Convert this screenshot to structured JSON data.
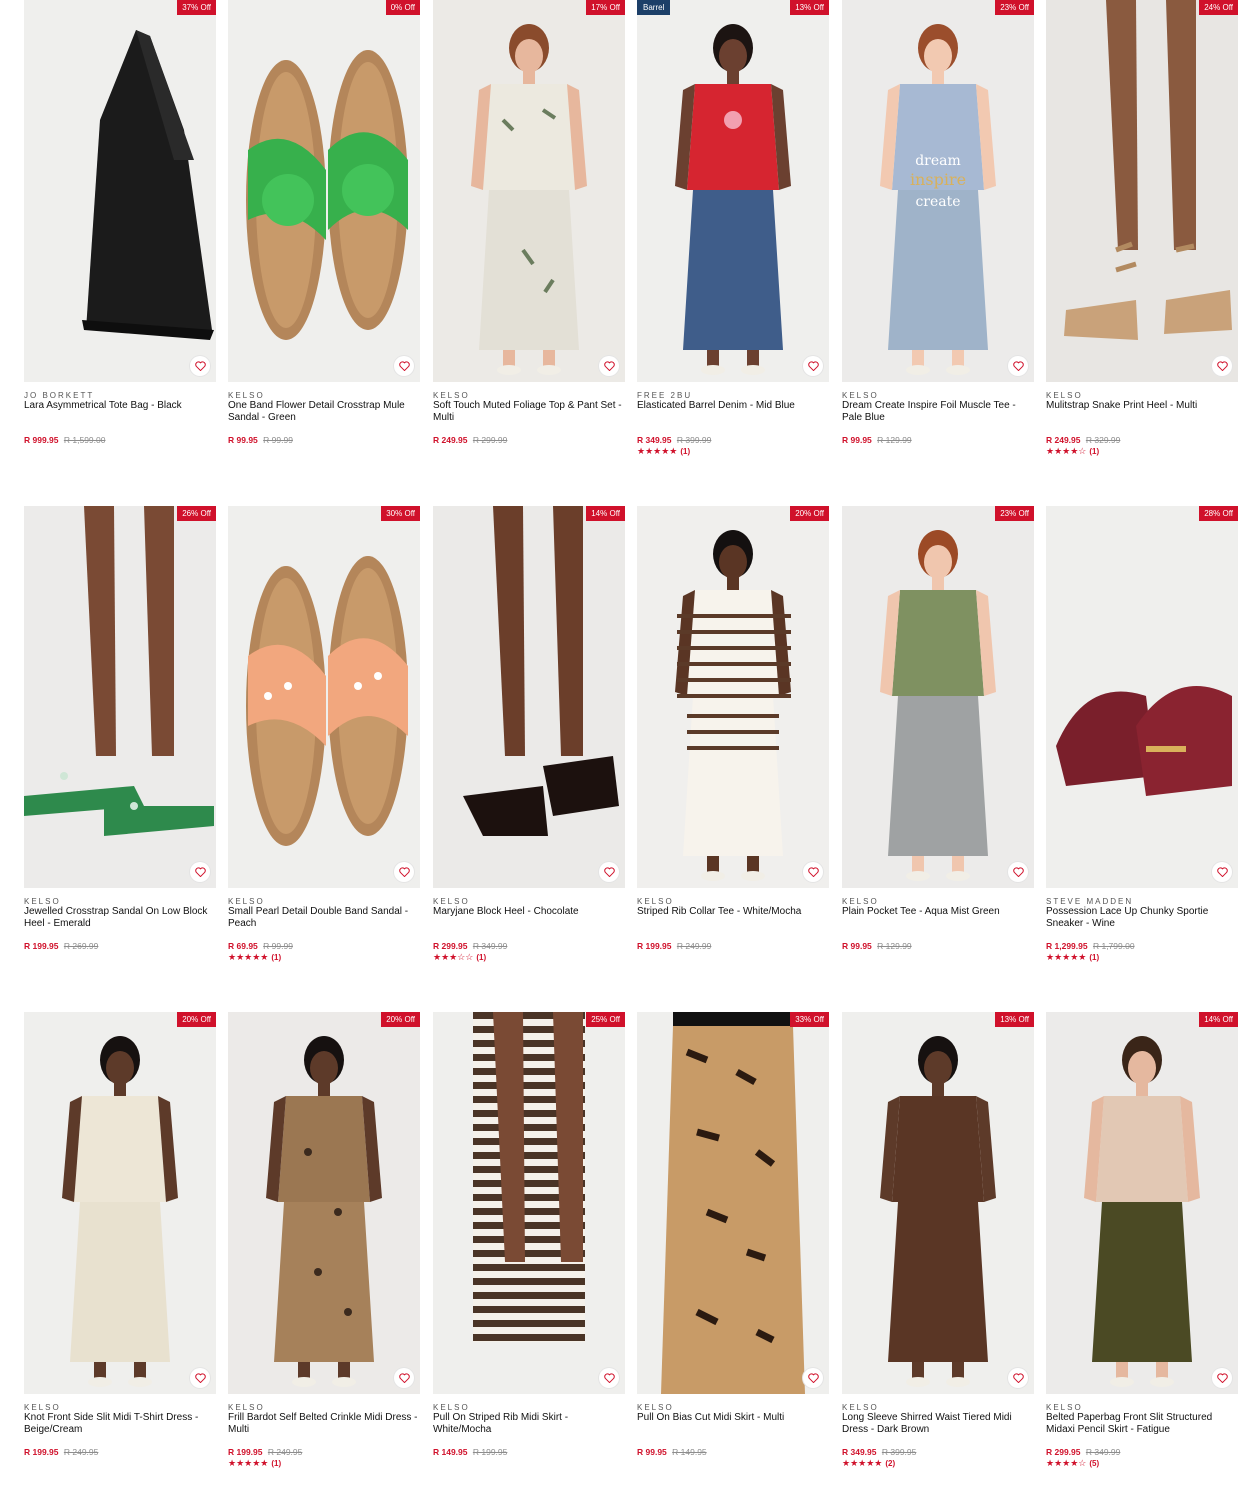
{
  "colors": {
    "accent": "#d0112b",
    "tag_blue": "#1c3f68",
    "strike": "#8d8d8d"
  },
  "products": [
    {
      "brand": "JO BORKETT",
      "name": "Lara Asymmetrical Tote Bag - Black",
      "price": "R 999.95",
      "was": "R 1,599.00",
      "badge": "37% Off",
      "rating": "",
      "count": "",
      "image": "tote-bag-image"
    },
    {
      "brand": "KELSO",
      "name": "One Band Flower Detail Crosstrap Mule Sandal - Green",
      "price": "R 99.95",
      "was": "R 99.99",
      "badge": "0% Off",
      "rating": "",
      "count": "",
      "image": "sandal-image"
    },
    {
      "brand": "KELSO",
      "name": "Soft Touch Muted Foliage Top & Pant Set - Multi",
      "price": "R 249.95",
      "was": "R 299.99",
      "badge": "17% Off",
      "rating": "",
      "count": "",
      "image": "pyjama-set-image"
    },
    {
      "brand": "FREE 2BU",
      "name": "Elasticated Barrel Denim - Mid Blue",
      "price": "R 349.95",
      "was": "R 399.99",
      "badge": "13% Off",
      "tag": "Barrel",
      "rating": "★★★★★",
      "count": "(1)",
      "image": "denim-image"
    },
    {
      "brand": "KELSO",
      "name": "Dream Create Inspire Foil Muscle Tee - Pale Blue",
      "price": "R 99.95",
      "was": "R 129.99",
      "badge": "23% Off",
      "rating": "",
      "count": "",
      "image": "tee-image"
    },
    {
      "brand": "KELSO",
      "name": "Mulitstrap Snake Print Heel - Multi",
      "price": "R 249.95",
      "was": "R 329.99",
      "badge": "24% Off",
      "rating": "★★★★☆",
      "count": "(1)",
      "image": "heel-image"
    },
    {
      "brand": "KELSO",
      "name": "Jewelled Crosstrap Sandal On Low Block Heel - Emerald",
      "price": "R 199.95",
      "was": "R 269.99",
      "badge": "26% Off",
      "rating": "",
      "count": "",
      "image": "sandal-image"
    },
    {
      "brand": "KELSO",
      "name": "Small Pearl Detail Double Band Sandal - Peach",
      "price": "R 69.95",
      "was": "R 99.99",
      "badge": "30% Off",
      "rating": "★★★★★",
      "count": "(1)",
      "image": "sandal-image"
    },
    {
      "brand": "KELSO",
      "name": "Maryjane Block Heel - Chocolate",
      "price": "R 299.95",
      "was": "R 349.99",
      "badge": "14% Off",
      "rating": "★★★☆☆",
      "count": "(1)",
      "image": "heel-image"
    },
    {
      "brand": "KELSO",
      "name": "Striped Rib Collar Tee - White/Mocha",
      "price": "R 199.95",
      "was": "R 249.99",
      "badge": "20% Off",
      "rating": "",
      "count": "",
      "image": "tee-image"
    },
    {
      "brand": "KELSO",
      "name": "Plain Pocket Tee - Aqua Mist Green",
      "price": "R 99.95",
      "was": "R 129.99",
      "badge": "23% Off",
      "rating": "",
      "count": "",
      "image": "tee-image"
    },
    {
      "brand": "STEVE MADDEN",
      "name": "Possession Lace Up Chunky Sportie Sneaker - Wine",
      "price": "R 1,299.95",
      "was": "R 1,799.00",
      "badge": "28% Off",
      "rating": "★★★★★",
      "count": "(1)",
      "image": "sneaker-image"
    },
    {
      "brand": "KELSO",
      "name": "Knot Front Side Slit Midi T-Shirt Dress - Beige/Cream",
      "price": "R 199.95",
      "was": "R 249.95",
      "badge": "20% Off",
      "rating": "",
      "count": "",
      "image": "dress-image"
    },
    {
      "brand": "KELSO",
      "name": "Frill Bardot Self Belted Crinkle Midi Dress - Multi",
      "price": "R 199.95",
      "was": "R 249.95",
      "badge": "20% Off",
      "rating": "★★★★★",
      "count": "(1)",
      "image": "dress-image"
    },
    {
      "brand": "KELSO",
      "name": "Pull On Striped Rib Midi Skirt - White/Mocha",
      "price": "R 149.95",
      "was": "R 199.95",
      "badge": "25% Off",
      "rating": "",
      "count": "",
      "image": "skirt-image"
    },
    {
      "brand": "KELSO",
      "name": "Pull On Bias Cut Midi Skirt - Multi",
      "price": "R 99.95",
      "was": "R 149.95",
      "badge": "33% Off",
      "rating": "",
      "count": "",
      "image": "skirt-image"
    },
    {
      "brand": "KELSO",
      "name": "Long Sleeve Shirred Waist Tiered Midi Dress - Dark Brown",
      "price": "R 349.95",
      "was": "R 399.95",
      "badge": "13% Off",
      "rating": "★★★★★",
      "count": "(2)",
      "image": "dress-image"
    },
    {
      "brand": "KELSO",
      "name": "Belted Paperbag Front Slit Structured Midaxi Pencil Skirt - Fatigue",
      "price": "R 299.95",
      "was": "R 349.99",
      "badge": "14% Off",
      "rating": "★★★★☆",
      "count": "(5)",
      "image": "skirt-image"
    }
  ]
}
